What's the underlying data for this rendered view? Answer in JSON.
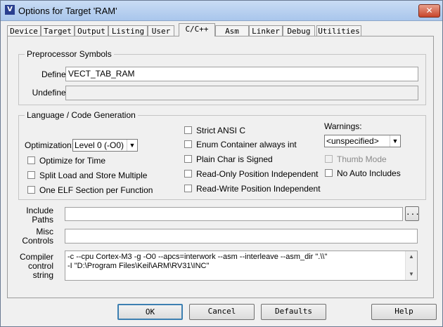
{
  "window": {
    "title": "Options for Target 'RAM'",
    "close_glyph": "✕"
  },
  "tabs": [
    "Device",
    "Target",
    "Output",
    "Listing",
    "User",
    "C/C++",
    "Asm",
    "Linker",
    "Debug",
    "Utilities"
  ],
  "preprocessor": {
    "legend": "Preprocessor Symbols",
    "define_label": "Define:",
    "define_value": "VECT_TAB_RAM",
    "undefine_label": "Undefine:",
    "undefine_value": ""
  },
  "language": {
    "legend": "Language / Code Generation",
    "optimization_label": "Optimization:",
    "optimization_value": "Level 0 (-O0)",
    "options": [
      "Optimize for Time",
      "Split Load and Store Multiple",
      "One ELF Section per Function",
      "Strict ANSI C",
      "Enum Container always int",
      "Plain Char is Signed",
      "Read-Only Position Independent",
      "Read-Write Position Independent",
      "Thumb Mode",
      "No Auto Includes"
    ],
    "warnings_label": "Warnings:",
    "warnings_value": "<unspecified>"
  },
  "include": {
    "label_1": "Include",
    "label_2": "Paths",
    "value": "",
    "browse": "..."
  },
  "misc": {
    "label_1": "Misc",
    "label_2": "Controls",
    "value": ""
  },
  "compiler": {
    "label_1": "Compiler",
    "label_2": "control",
    "label_3": "string",
    "line_1": "-c --cpu Cortex-M3 -g -O0 --apcs=interwork --asm --interleave --asm_dir \".\\\\\"",
    "line_2": "-I \"D:\\Program Files\\Keil\\ARM\\RV31\\INC\""
  },
  "buttons": {
    "ok": "OK",
    "cancel": "Cancel",
    "defaults": "Defaults",
    "help": "Help"
  }
}
